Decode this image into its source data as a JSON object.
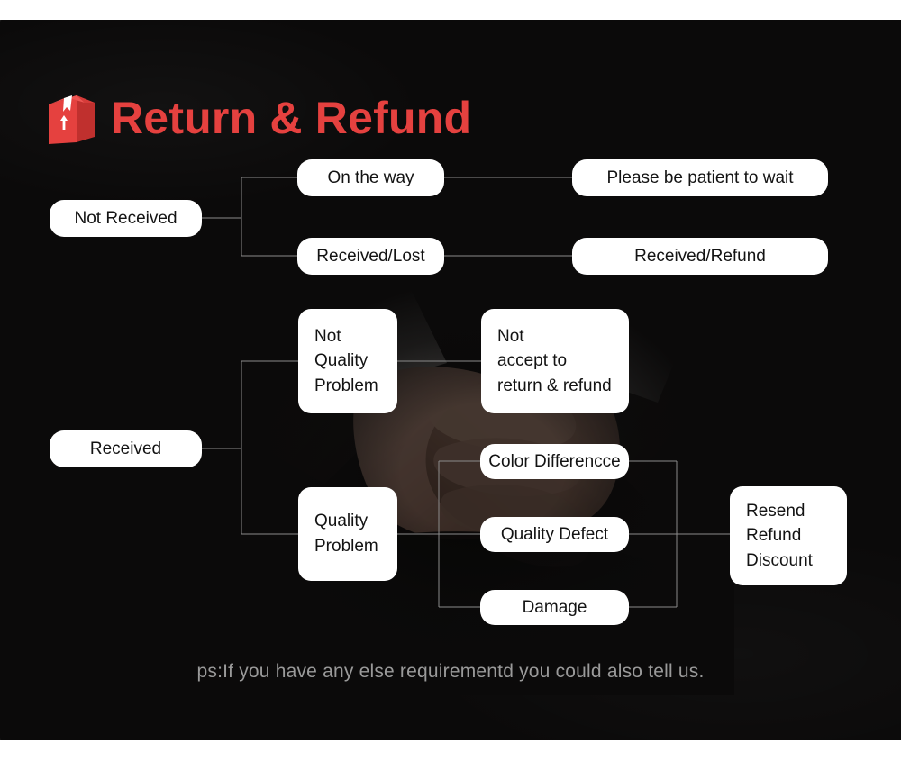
{
  "header": {
    "title": "Return & Refund",
    "icon": "package-box-icon",
    "title_color": "#e5413f"
  },
  "background": {
    "panel_color": "#0b0a0a",
    "photo_subject": "handshake-photo"
  },
  "flowchart": {
    "line_color": "#8b8b8b",
    "node_fill": "#ffffff",
    "node_text_color": "#131313",
    "nodes": [
      {
        "id": "not-received",
        "label": "Not Received"
      },
      {
        "id": "on-the-way",
        "label": "On the way"
      },
      {
        "id": "received-lost",
        "label": "Received/Lost"
      },
      {
        "id": "please-wait",
        "label": "Please be patient to wait"
      },
      {
        "id": "received-refund",
        "label": "Received/Refund"
      },
      {
        "id": "received",
        "label": "Received"
      },
      {
        "id": "not-quality-problem",
        "label": "Not\nQuality\nProblem"
      },
      {
        "id": "not-accept",
        "label": "Not\naccept to\nreturn & refund"
      },
      {
        "id": "quality-problem",
        "label": "Quality\nProblem"
      },
      {
        "id": "color-difference",
        "label": "Color Differencce"
      },
      {
        "id": "quality-defect",
        "label": "Quality Defect"
      },
      {
        "id": "damage",
        "label": "Damage"
      },
      {
        "id": "resolution",
        "label": "Resend\nRefund\nDiscount"
      }
    ]
  },
  "footer": {
    "note": "ps:If you have any else requirementd you could also tell us.",
    "note_color": "#9a9a9a"
  }
}
